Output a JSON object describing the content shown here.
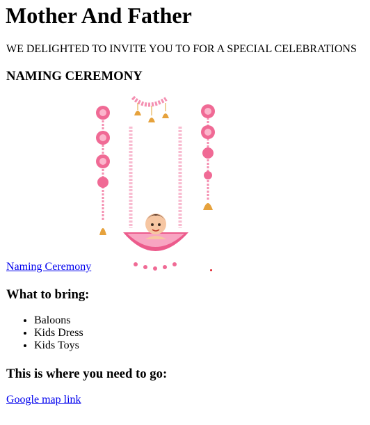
{
  "header": {
    "title": "Mother And Father"
  },
  "invitation": {
    "intro": "WE DELIGHTED TO INVITE YOU TO FOR A SPECIAL CELEBRATIONS",
    "event_title": "NAMING CEREMONY",
    "link_text": "Naming Ceremony"
  },
  "bring": {
    "title": "What to bring:",
    "items": [
      "Baloons",
      "Kids Dress",
      "Kids Toys"
    ]
  },
  "location": {
    "title": "This is where you need to go:",
    "map_link_text": "Google map link"
  },
  "colors": {
    "link": "#0000ee",
    "flower_pink": "#f06a95",
    "bell_gold": "#e0a030"
  }
}
